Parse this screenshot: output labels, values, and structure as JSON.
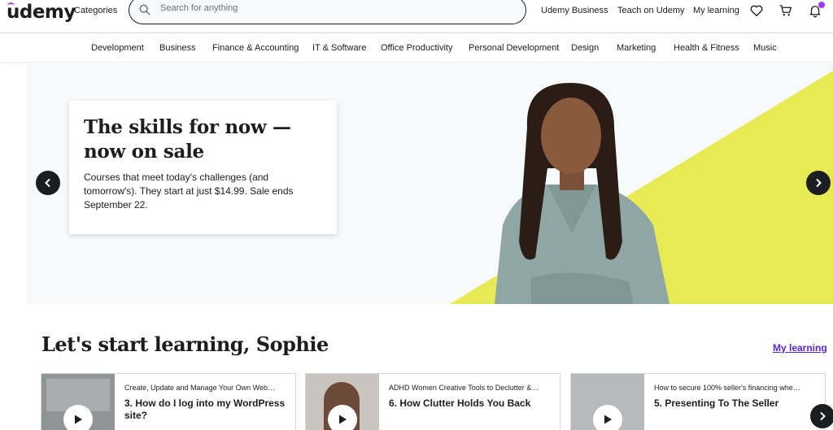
{
  "header": {
    "logo": "udemy",
    "categories": "Categories",
    "search_placeholder": "Search for anything",
    "links": {
      "business": "Udemy Business",
      "teach": "Teach on Udemy",
      "my_learning": "My learning"
    },
    "icons": {
      "search": "search-icon",
      "wishlist": "heart-icon",
      "cart": "cart-icon",
      "notifications": "bell-icon"
    }
  },
  "categories": [
    "Development",
    "Business",
    "Finance & Accounting",
    "IT & Software",
    "Office Productivity",
    "Personal Development",
    "Design",
    "Marketing",
    "Health & Fitness",
    "Music"
  ],
  "hero": {
    "title": "The skills for now — now on sale",
    "text": "Courses that meet today's challenges (and tomorrow's). They start at just $14.99. Sale ends September 22.",
    "accent_color": "#e7ea55"
  },
  "learning": {
    "title": "Let's start learning, Sophie",
    "my_learning_link": "My learning",
    "courses": [
      {
        "subtitle": "Create, Update and Manage Your Own Web…",
        "name": "3. How do I log into my WordPress site?"
      },
      {
        "subtitle": "ADHD Women Creative Tools to Declutter &…",
        "name": "6. How Clutter Holds You Back"
      },
      {
        "subtitle": "How to secure 100% seller's financing whe…",
        "name": "5. Presenting To The Seller"
      }
    ]
  },
  "colors": {
    "brand_purple": "#a435f0",
    "link_purple": "#5624d0",
    "dark": "#1c1d1f"
  }
}
